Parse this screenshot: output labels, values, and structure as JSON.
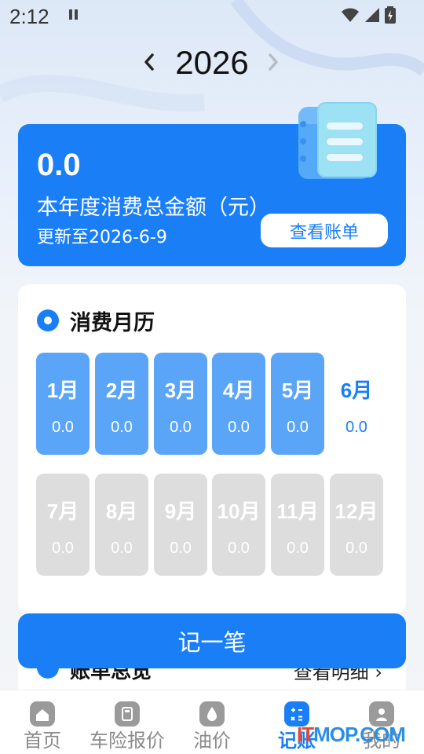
{
  "status_bar": {
    "time": "2:12"
  },
  "year_selector": {
    "year": "2026"
  },
  "summary": {
    "amount": "0.0",
    "title": "本年度消费总金额（元）",
    "updated": "更新至2026-6-9",
    "view_bill_label": "查看账单"
  },
  "calendar": {
    "title": "消费月历",
    "months": [
      {
        "name": "1月",
        "value": "0.0",
        "state": "past"
      },
      {
        "name": "2月",
        "value": "0.0",
        "state": "past"
      },
      {
        "name": "3月",
        "value": "0.0",
        "state": "past"
      },
      {
        "name": "4月",
        "value": "0.0",
        "state": "past"
      },
      {
        "name": "5月",
        "value": "0.0",
        "state": "past"
      },
      {
        "name": "6月",
        "value": "0.0",
        "state": "current"
      },
      {
        "name": "7月",
        "value": "0.0",
        "state": "future"
      },
      {
        "name": "8月",
        "value": "0.0",
        "state": "future"
      },
      {
        "name": "9月",
        "value": "0.0",
        "state": "future"
      },
      {
        "name": "10月",
        "value": "0.0",
        "state": "future"
      },
      {
        "name": "11月",
        "value": "0.0",
        "state": "future"
      },
      {
        "name": "12月",
        "value": "0.0",
        "state": "future"
      }
    ]
  },
  "record_button_label": "记一笔",
  "overview": {
    "title": "账单总览",
    "link": "查看明细 ›"
  },
  "bottom_nav": [
    {
      "label": "首页",
      "icon": "home-icon",
      "active": false
    },
    {
      "label": "车险报价",
      "icon": "calculator-icon",
      "active": false
    },
    {
      "label": "油价",
      "icon": "oil-drop-icon",
      "active": false
    },
    {
      "label": "记账",
      "icon": "ledger-icon",
      "active": true
    },
    {
      "label": "我的",
      "icon": "profile-icon",
      "active": false
    }
  ],
  "watermark": {
    "prefix": "IT",
    "suffix": "MOP.COM"
  },
  "colors": {
    "accent": "#1a7ff7",
    "past_tile": "#5aa5f7",
    "future_tile": "#dddddd"
  }
}
